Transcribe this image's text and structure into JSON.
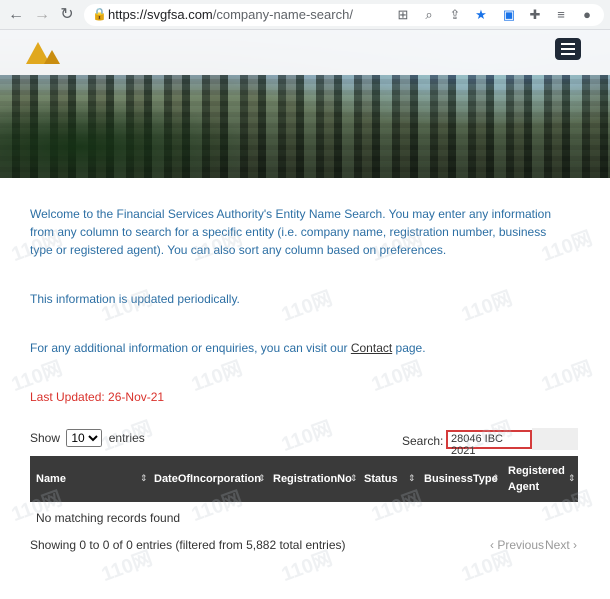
{
  "browser": {
    "url_host": "https://svgfsa.com",
    "url_path": "/company-name-search/"
  },
  "intro": {
    "welcome": "Welcome to the Financial Services Authority's Entity Name Search. You may enter any information from any column to search for a specific entity (i.e. company name, registration number, business type or registered agent). You can also sort any column based on preferences.",
    "periodic": "This information is updated periodically.",
    "contact_prefix": "For any additional information or enquiries, you can visit our ",
    "contact_link": "Contact",
    "contact_suffix": " page.",
    "last_updated": "Last Updated:  26-Nov-21"
  },
  "table_controls": {
    "show_label": "Show",
    "show_value": "10",
    "entries_label": "entries",
    "search_label": "Search:",
    "search_value": "28046 IBC 2021"
  },
  "table": {
    "columns": [
      "Name",
      "DateOfIncorporation",
      "RegistrationNo",
      "Status",
      "BusinessType",
      "Registered Agent"
    ],
    "empty_message": "No matching records found",
    "info": "Showing 0 to 0 of 0 entries (filtered from 5,882 total entries)",
    "previous": "Previous",
    "next": "Next"
  },
  "watermark": "110网",
  "colors": {
    "intro_text": "#2c6fa4",
    "updated": "#d9322c",
    "header_bg": "#3a3a3a",
    "highlight": "#d43b3b"
  }
}
